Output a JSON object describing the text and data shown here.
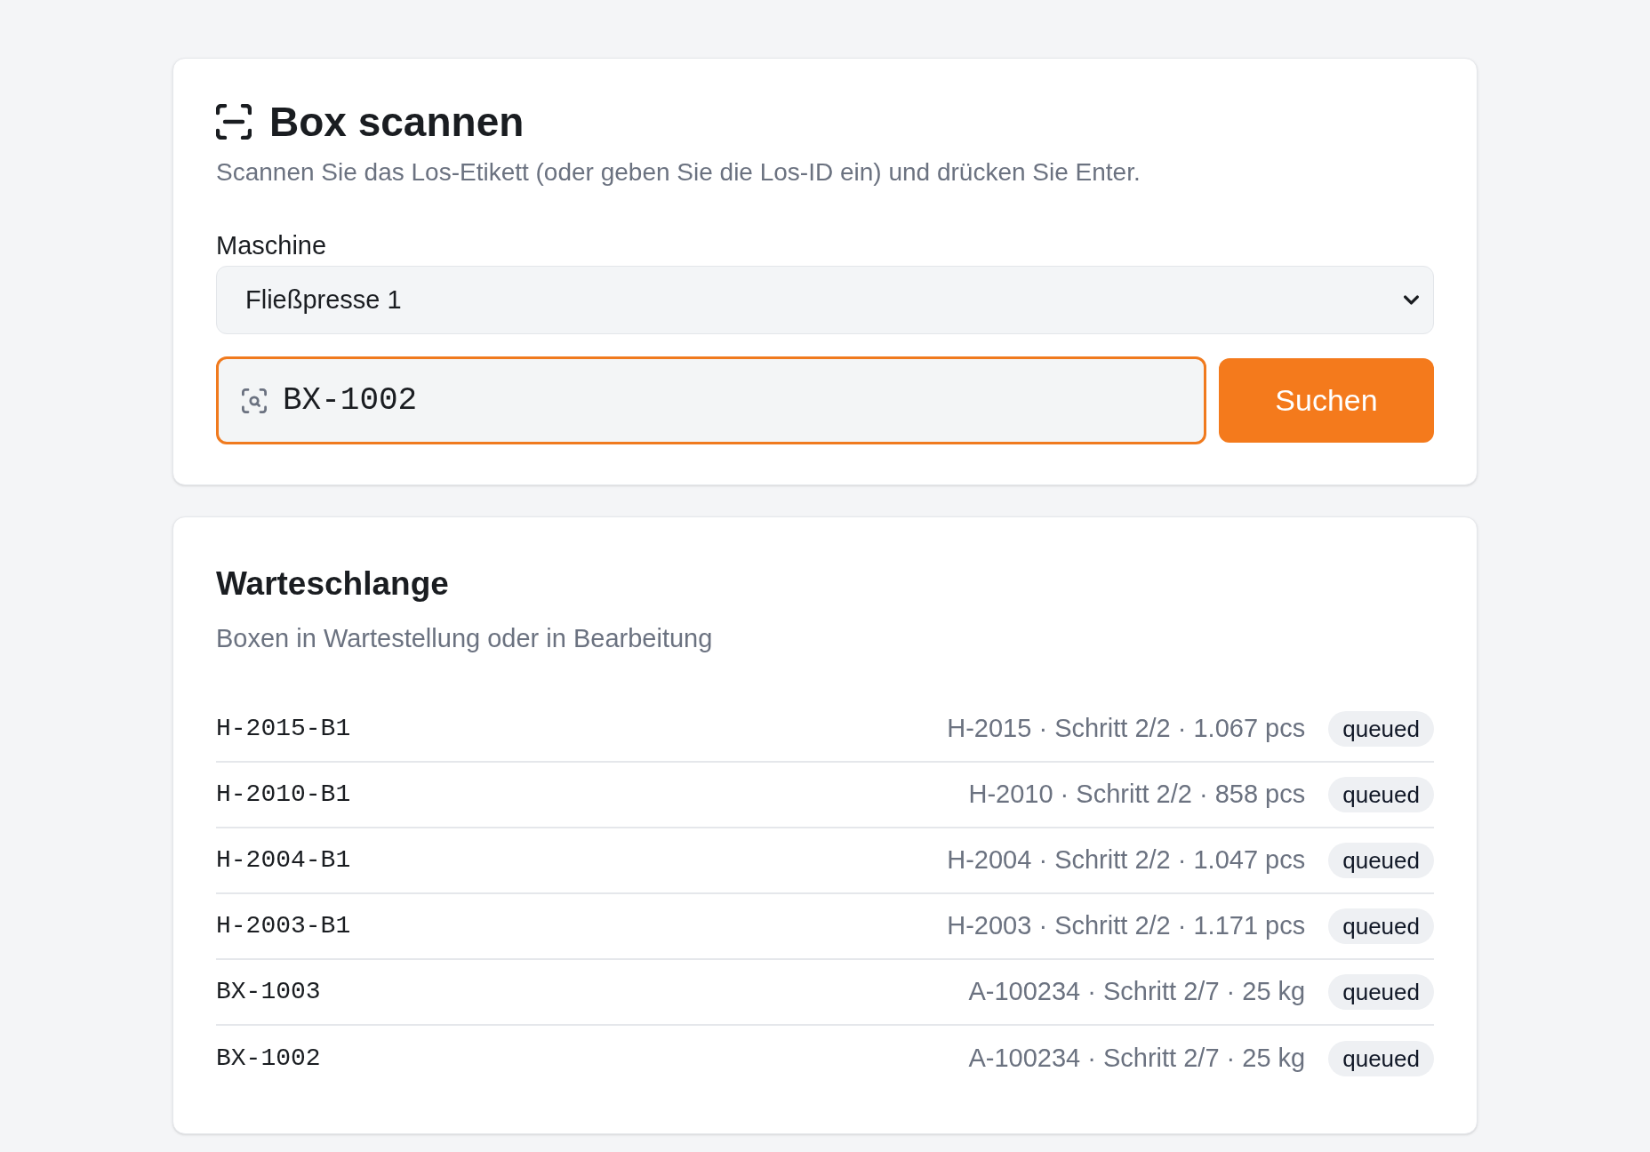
{
  "scan_card": {
    "title": "Box scannen",
    "description": "Scannen Sie das Los-Etikett (oder geben Sie die Los-ID ein) und drücken Sie Enter.",
    "machine": {
      "label": "Maschine",
      "value": "Fließpresse 1"
    },
    "scan_input": {
      "value": "BX-1002",
      "focused": true
    },
    "search_button": "Suchen"
  },
  "queue": {
    "title": "Warteschlange",
    "description": "Boxen in Wartestellung oder in Bearbeitung",
    "items": [
      {
        "id": "H-2015-B1",
        "details": "H-2015 · Schritt 2/2 · 1.067 pcs",
        "status": "queued"
      },
      {
        "id": "H-2010-B1",
        "details": "H-2010 · Schritt 2/2 · 858 pcs",
        "status": "queued"
      },
      {
        "id": "H-2004-B1",
        "details": "H-2004 · Schritt 2/2 · 1.047 pcs",
        "status": "queued"
      },
      {
        "id": "H-2003-B1",
        "details": "H-2003 · Schritt 2/2 · 1.171 pcs",
        "status": "queued"
      },
      {
        "id": "BX-1003",
        "details": "A-100234 · Schritt 2/7 · 25 kg",
        "status": "queued"
      },
      {
        "id": "BX-1002",
        "details": "A-100234 · Schritt 2/7 · 25 kg",
        "status": "queued"
      }
    ]
  }
}
